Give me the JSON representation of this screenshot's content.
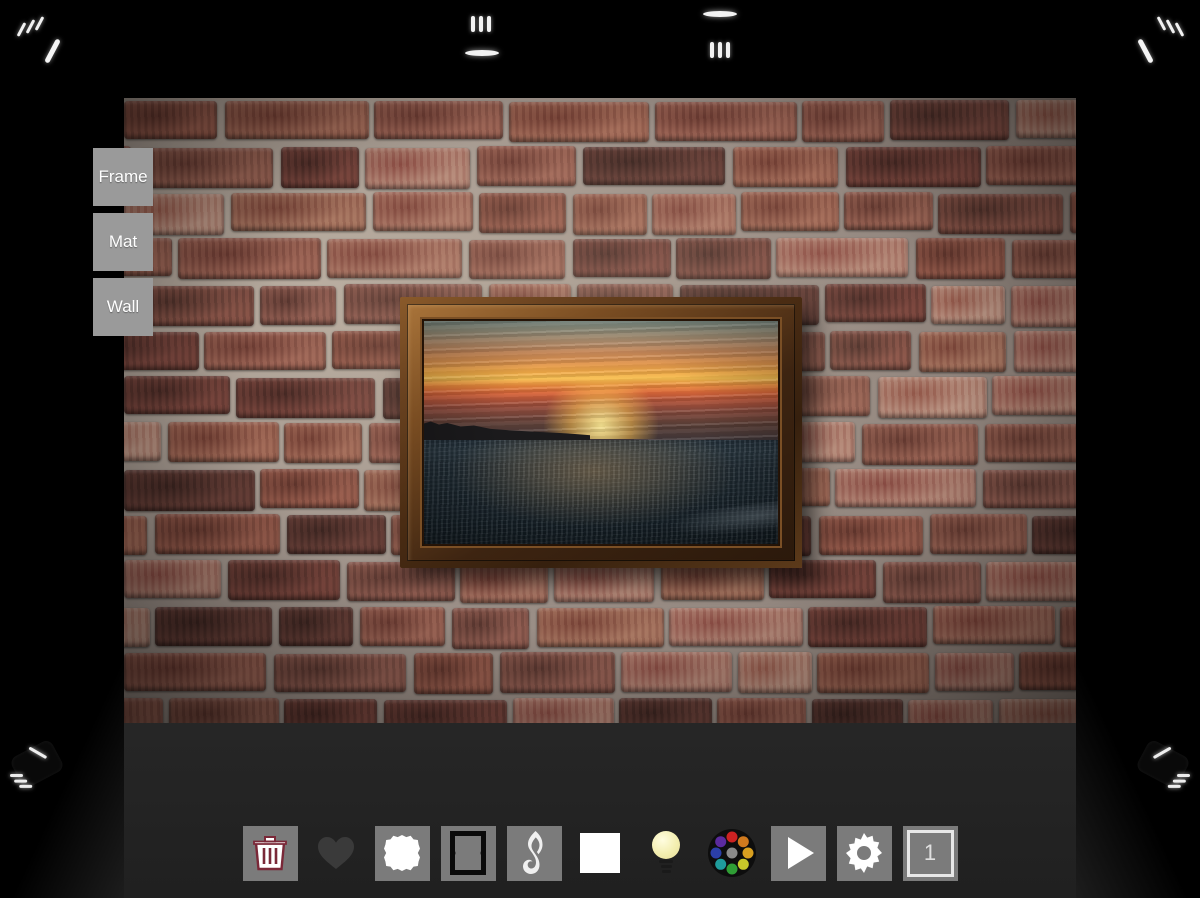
{
  "app": {
    "scene_name": "virtual-gallery-wall",
    "wall_material": "brick",
    "artwork_title": "Ocean Sunset"
  },
  "side_tabs": [
    {
      "label": "Frame",
      "name": "frame"
    },
    {
      "label": "Mat",
      "name": "mat"
    },
    {
      "label": "Wall",
      "name": "wall"
    }
  ],
  "ceiling_lights": [
    {
      "name": "ceiling-light-left",
      "style": "streak-dashes"
    },
    {
      "name": "ceiling-light-center-left",
      "style": "dashes-over-ellipse"
    },
    {
      "name": "ceiling-light-center-right",
      "style": "ellipse-over-dashes"
    },
    {
      "name": "ceiling-light-right",
      "style": "streak-dashes"
    }
  ],
  "floor_lamps": [
    {
      "name": "floor-lamp-left"
    },
    {
      "name": "floor-lamp-right"
    }
  ],
  "toolbar": {
    "items": [
      {
        "icon": "trash-icon",
        "label": "Delete",
        "has_background": true,
        "selected": false
      },
      {
        "icon": "heart-icon",
        "label": "Favorite",
        "has_background": false,
        "selected": false
      },
      {
        "icon": "mat-icon",
        "label": "Mat",
        "has_background": true,
        "selected": false
      },
      {
        "icon": "frame-icon",
        "label": "Frame",
        "has_background": true,
        "selected": false
      },
      {
        "icon": "music-note-icon",
        "label": "Music",
        "has_background": true,
        "selected": false
      },
      {
        "icon": "white-square-icon",
        "label": "Background",
        "has_background": false,
        "selected": false
      },
      {
        "icon": "light-bulb-icon",
        "label": "Lighting",
        "has_background": false,
        "selected": false
      },
      {
        "icon": "color-wheel-icon",
        "label": "Color",
        "has_background": false,
        "selected": false
      },
      {
        "icon": "play-icon",
        "label": "Slideshow",
        "has_background": true,
        "selected": false
      },
      {
        "icon": "gear-icon",
        "label": "Settings",
        "has_background": true,
        "selected": false
      },
      {
        "icon": "count-badge-icon",
        "label": "1",
        "has_background": true,
        "selected": false
      }
    ],
    "page_count": "1"
  },
  "colors": {
    "tab_background": "#9a9a9a",
    "toolbar_button_background": "#7b7b7b",
    "trash_accent": "#7a2838",
    "bulb_glass": "#f3eeb0",
    "heart_inactive": "#3a3a3a",
    "frame_wood": "#6b4320",
    "backdrop": "#000000"
  },
  "color_wheel": {
    "swatches": [
      "#cc2222",
      "#d07a1e",
      "#c8c82a",
      "#2f9e35",
      "#1f9c9c",
      "#2b3fa8",
      "#5b2a9e",
      "#8a1f7a"
    ],
    "center": "#8a8a8a"
  }
}
